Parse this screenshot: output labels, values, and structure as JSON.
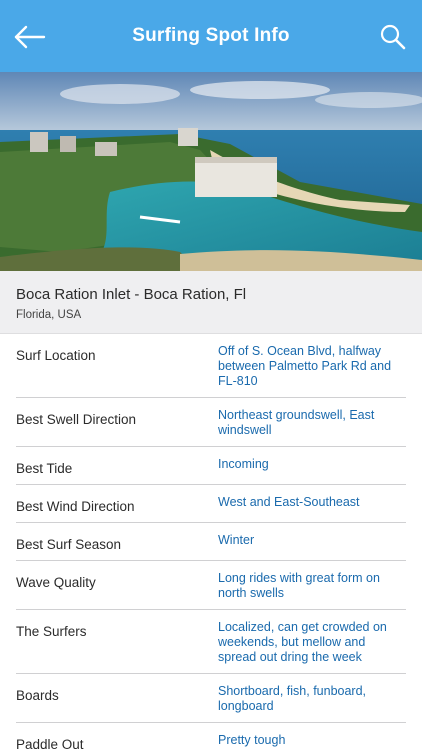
{
  "navbar": {
    "title": "Surfing Spot Info",
    "back_icon": "arrow-left-icon",
    "search_icon": "search-icon",
    "background": "#4aa8e8"
  },
  "hero": {
    "description_icon": "aerial-photo"
  },
  "spot": {
    "name": "Boca Ration Inlet - Boca Ration, Fl",
    "region": "Florida, USA"
  },
  "details": [
    {
      "label": "Surf Location",
      "value": "Off of S. Ocean Blvd, halfway between Palmetto Park Rd and FL-810"
    },
    {
      "label": "Best Swell Direction",
      "value": "Northeast groundswell, East windswell"
    },
    {
      "label": "Best Tide",
      "value": "Incoming"
    },
    {
      "label": "Best Wind Direction",
      "value": "West and East-Southeast"
    },
    {
      "label": "Best Surf Season",
      "value": "Winter"
    },
    {
      "label": "Wave Quality",
      "value": "Long rides with great form on north swells"
    },
    {
      "label": "The Surfers",
      "value": "Localized, can get crowded on weekends, but mellow and spread out dring the week"
    },
    {
      "label": "Boards",
      "value": "Shortboard, fish, funboard, longboard"
    },
    {
      "label": "Paddle Out",
      "value": "Pretty tough"
    }
  ],
  "colors": {
    "value_text": "#1a6aad",
    "header_bg": "#efeff1"
  }
}
